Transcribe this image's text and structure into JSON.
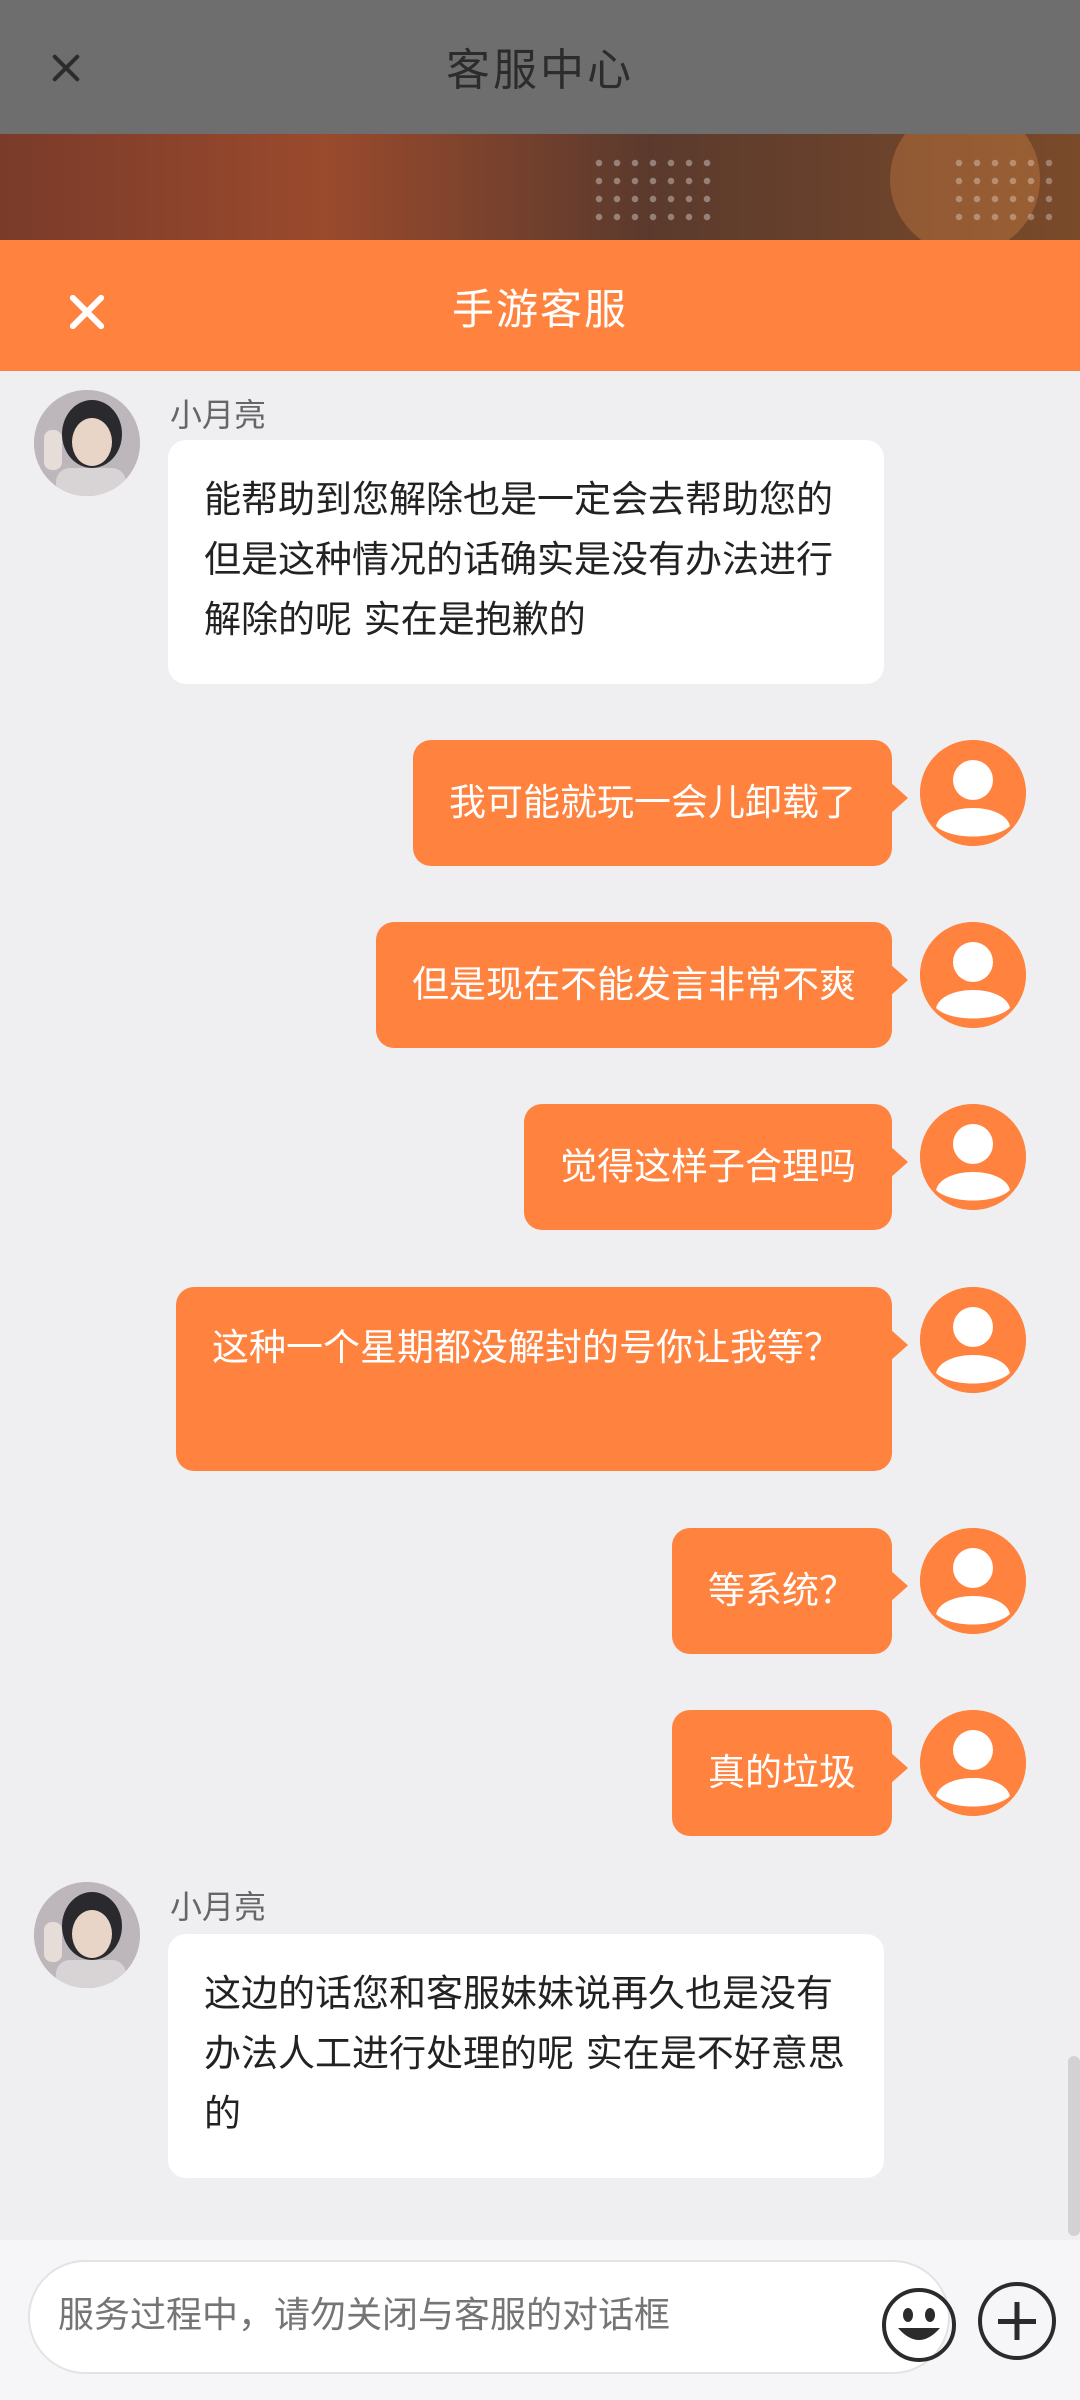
{
  "background_page": {
    "title": "客服中心"
  },
  "chat_sheet": {
    "title": "手游客服"
  },
  "messages": [
    {
      "sender": "agent",
      "name": "小月亮",
      "text": "能帮助到您解除也是一定会去帮助您的 但是这种情况的话确实是没有办法进行解除的呢 实在是抱歉的"
    },
    {
      "sender": "user",
      "text": "我可能就玩一会儿卸载了"
    },
    {
      "sender": "user",
      "text": "但是现在不能发言非常不爽"
    },
    {
      "sender": "user",
      "text": "觉得这样子合理吗"
    },
    {
      "sender": "user",
      "text": "这种一个星期都没解封的号你让我等？"
    },
    {
      "sender": "user",
      "text": "等系统？"
    },
    {
      "sender": "user",
      "text": "真的垃圾"
    },
    {
      "sender": "agent",
      "name": "小月亮",
      "text": "这边的话您和客服妹妹说再久也是没有办法人工进行处理的呢 实在是不好意思的"
    }
  ],
  "input": {
    "placeholder": "服务过程中，请勿关闭与客服的对话框"
  },
  "colors": {
    "accent": "#ff823e",
    "page_background": "#efeff1",
    "agent_bubble": "#ffffff"
  },
  "icons": {
    "emoji_button": "smiley-face-icon",
    "more_button": "plus-circle-icon",
    "close": "close-icon",
    "user_avatar": "default-user-icon"
  }
}
